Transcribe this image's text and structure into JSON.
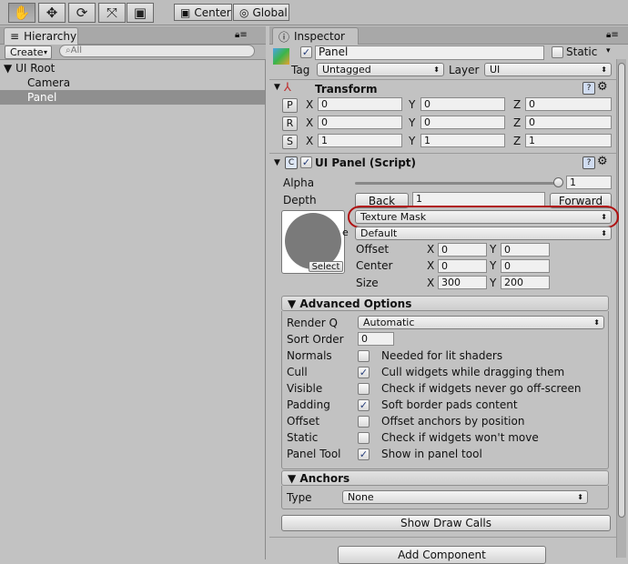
{
  "toolbar": {
    "tools": [
      "hand-icon",
      "move-icon",
      "rotate-icon",
      "scale-icon",
      "rect-icon"
    ],
    "pivot_label": "Center",
    "space_label": "Global"
  },
  "hierarchy": {
    "tab_label": "Hierarchy",
    "create_label": "Create",
    "search_placeholder": "All",
    "items": [
      {
        "label": "UI Root"
      },
      {
        "label": "Camera"
      },
      {
        "label": "Panel"
      }
    ]
  },
  "inspector": {
    "tab_label": "Inspector",
    "object_name": "Panel",
    "static_label": "Static",
    "tag_label": "Tag",
    "tag_value": "Untagged",
    "layer_label": "Layer",
    "layer_value": "UI"
  },
  "transform": {
    "title": "Transform",
    "rows": [
      {
        "btn": "P",
        "x": "0",
        "y": "0",
        "z": "0"
      },
      {
        "btn": "R",
        "x": "0",
        "y": "0",
        "z": "0"
      },
      {
        "btn": "S",
        "x": "1",
        "y": "1",
        "z": "1"
      }
    ],
    "axis_x": "X",
    "axis_y": "Y",
    "axis_z": "Z"
  },
  "uipanel": {
    "title": "UI Panel (Script)",
    "alpha_label": "Alpha",
    "alpha_value": "1",
    "alpha_level": 1.0,
    "depth_label": "Depth",
    "back_label": "Back",
    "depth_value": "1",
    "forward_label": "Forward",
    "clipping_value": "Texture Mask",
    "clip_second_value": "Default",
    "clip_row_label_tail": "e",
    "select_label": "Select",
    "offset_label": "Offset",
    "center_label": "Center",
    "size_label": "Size",
    "offset_x": "0",
    "offset_y": "0",
    "center_x": "0",
    "center_y": "0",
    "size_x": "300",
    "size_y": "200"
  },
  "advanced": {
    "title": "Advanced Options",
    "render_q_label": "Render Q",
    "render_q_value": "Automatic",
    "sort_order_label": "Sort Order",
    "sort_order_value": "0",
    "options": [
      {
        "label": "Normals",
        "checked": false,
        "desc": "Needed for lit shaders"
      },
      {
        "label": "Cull",
        "checked": true,
        "desc": "Cull widgets while dragging them"
      },
      {
        "label": "Visible",
        "checked": false,
        "desc": "Check if widgets never go off-screen"
      },
      {
        "label": "Padding",
        "checked": true,
        "desc": "Soft border pads content"
      },
      {
        "label": "Offset",
        "checked": false,
        "desc": "Offset anchors by position"
      },
      {
        "label": "Static",
        "checked": false,
        "desc": "Check if widgets won't move"
      },
      {
        "label": "Panel Tool",
        "checked": true,
        "desc": "Show in panel tool"
      }
    ]
  },
  "anchors": {
    "title": "Anchors",
    "type_label": "Type",
    "type_value": "None"
  },
  "buttons": {
    "show_draw_calls": "Show Draw Calls",
    "add_component": "Add Component"
  },
  "colors": {
    "highlight_ellipse": "#b01010",
    "selected_row": "#8f8f8f"
  }
}
